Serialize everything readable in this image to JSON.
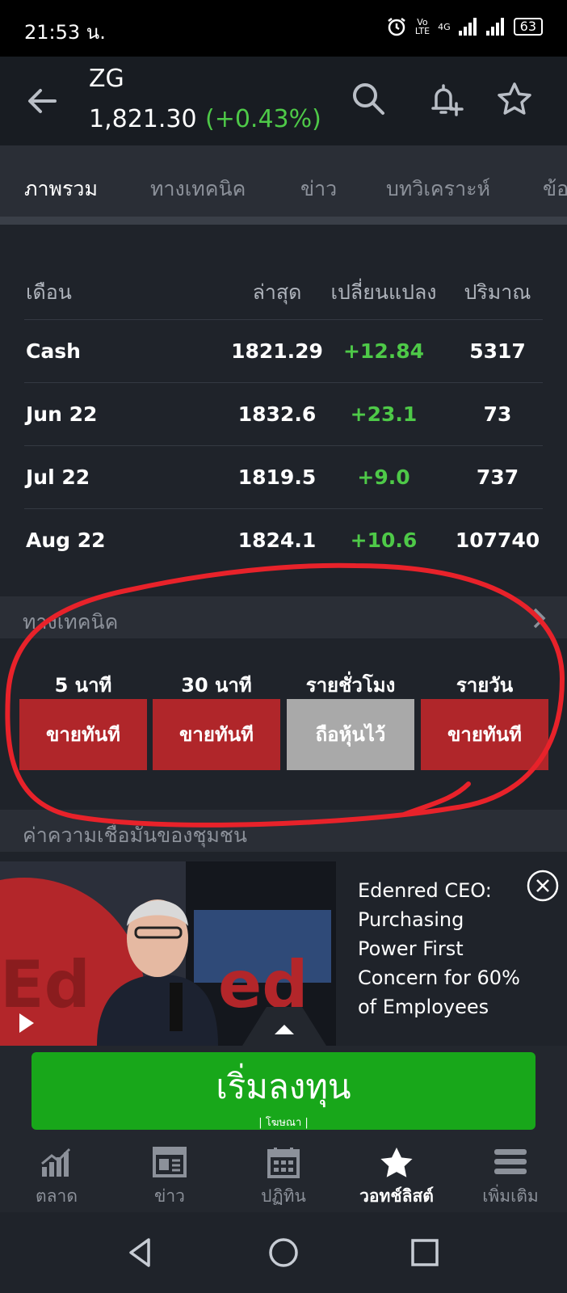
{
  "status_bar": {
    "time": "21:53 น.",
    "battery": "63",
    "volte_top": "Vo",
    "volte_bottom": "LTE",
    "network": "4G"
  },
  "header": {
    "symbol": "ZG",
    "price": "1,821.30",
    "change_pct": "(+0.43%)"
  },
  "tabs": [
    {
      "label": "ภาพรวม",
      "active": true
    },
    {
      "label": "ทางเทคนิค",
      "active": false
    },
    {
      "label": "ข่าว",
      "active": false
    },
    {
      "label": "บทวิเคราะห์",
      "active": false
    },
    {
      "label": "ข้อ",
      "active": false
    }
  ],
  "futures_table": {
    "headers": [
      "เดือน",
      "ล่าสุด",
      "เปลี่ยนแปลง",
      "ปริมาณ"
    ],
    "rows": [
      [
        "Cash",
        "1821.29",
        "+12.84",
        "5317"
      ],
      [
        "Jun 22",
        "1832.6",
        "+23.1",
        "73"
      ],
      [
        "Jul 22",
        "1819.5",
        "+9.0",
        "737"
      ],
      [
        "Aug 22",
        "1824.1",
        "+10.6",
        "107740"
      ]
    ]
  },
  "technical": {
    "title": "ทางเทคนิค",
    "timeframes": [
      "5 นาที",
      "30 นาที",
      "รายชั่วโมง",
      "รายวัน"
    ],
    "signals": [
      "ขายทันที",
      "ขายทันที",
      "ถือหุ้นไว้",
      "ขายทันที"
    ],
    "signal_colors": {
      "sell": "#b0262a",
      "neutral": "#a9a9a9"
    }
  },
  "next_section_title": "ค่าความเชื่อมั่นของชุมชน",
  "ad": {
    "headline": "Edenred CEO: Purchasing Power First Concern for 60% of Employees"
  },
  "invest_button": {
    "label": "เริ่มลงทุน",
    "ad_tag": "| โฆษณา |"
  },
  "bottom_nav": [
    {
      "label": "ตลาด",
      "icon": "chart-icon",
      "active": false
    },
    {
      "label": "ข่าว",
      "icon": "news-icon",
      "active": false
    },
    {
      "label": "ปฏิทิน",
      "icon": "calendar-icon",
      "active": false
    },
    {
      "label": "วอทช์ลิสต์",
      "icon": "star-icon",
      "active": true
    },
    {
      "label": "เพิ่มเติม",
      "icon": "menu-icon",
      "active": false
    }
  ],
  "colors": {
    "up": "#4ec948",
    "accent_green": "#18a71a",
    "annotation": "#e8222a"
  }
}
